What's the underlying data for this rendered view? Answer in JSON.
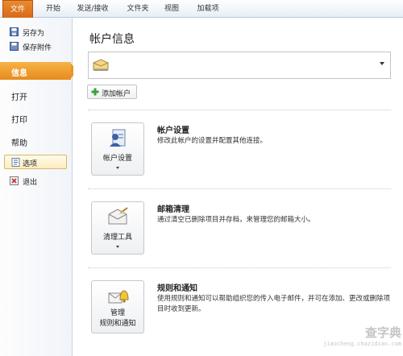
{
  "ribbon": {
    "tabs": [
      "文件",
      "开始",
      "发送/接收",
      "文件夹",
      "视图",
      "加载项"
    ],
    "active_color": "#dd7020"
  },
  "menu": {
    "save_as": "另存为",
    "save_attachments": "保存附件",
    "info": "信息",
    "open": "打开",
    "print": "打印",
    "help": "帮助",
    "options": "选项",
    "exit": "退出",
    "active_color": "#eb9627"
  },
  "main": {
    "title": "帐户信息",
    "add_account": "添加帐户",
    "sections": [
      {
        "button_label": "帐户设置",
        "title": "帐户设置",
        "description": "修改此帐户的设置并配置其他连接。"
      },
      {
        "button_label": "清理工具",
        "title": "邮箱清理",
        "description": "通过清空已删除项目并存档，来管理您的邮箱大小。"
      },
      {
        "button_label_line1": "管理",
        "button_label_line2": "规则和通知",
        "title": "规则和通知",
        "description": "使用规则和通知可以帮助组织您的传入电子邮件，并可在添加、更改或删除项目时收到更新。"
      }
    ]
  },
  "watermark": {
    "line1": "查字典",
    "line2": "jiaocheng.chazidian.com"
  }
}
